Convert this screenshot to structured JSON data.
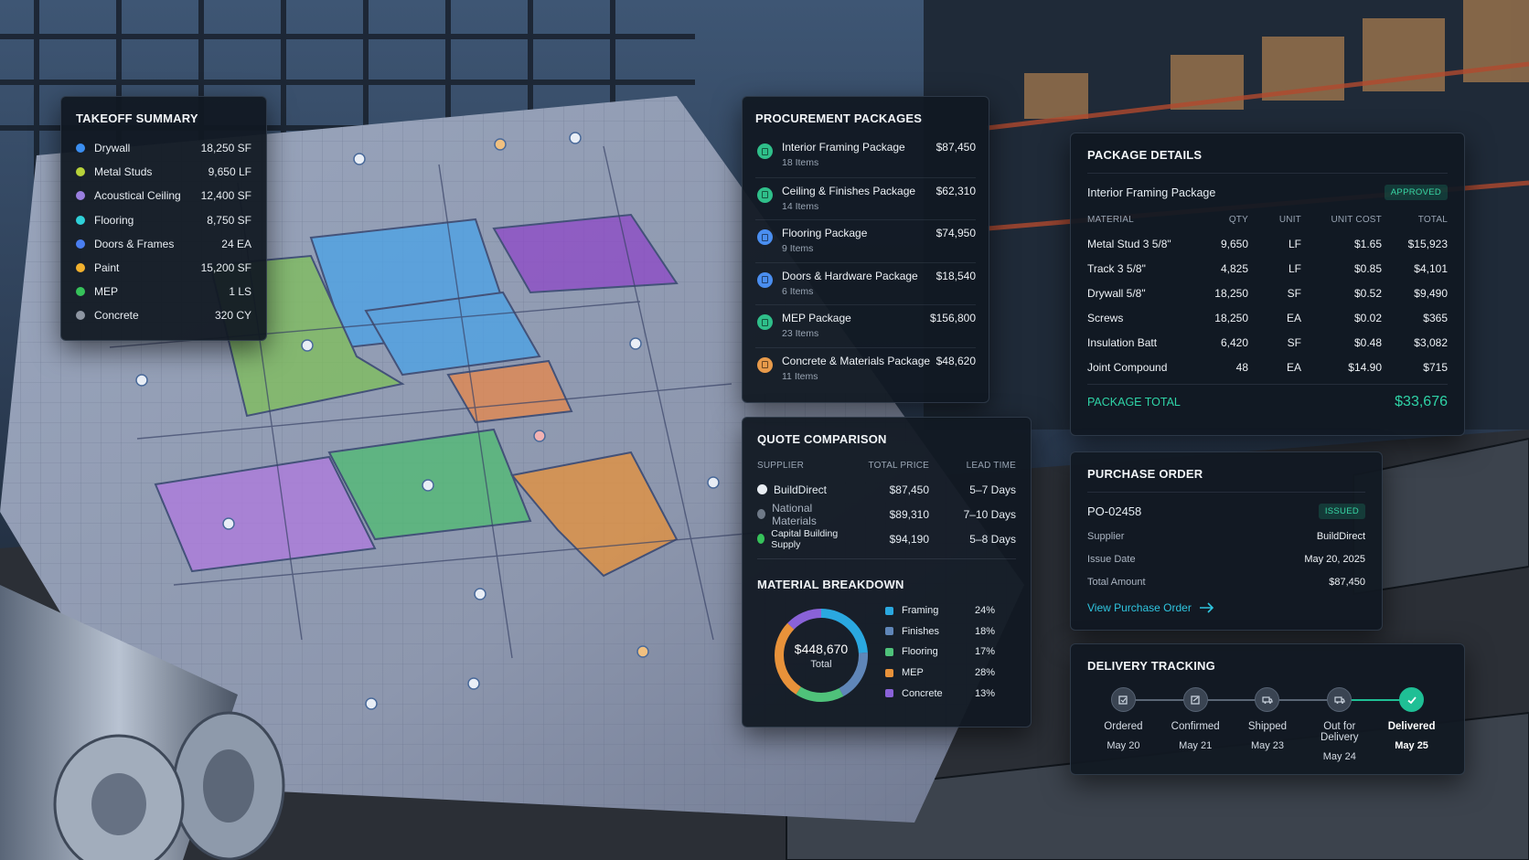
{
  "takeoff": {
    "title": "TAKEOFF SUMMARY",
    "items": [
      {
        "label": "Drywall",
        "value": "18,250 SF",
        "color": "#3b8ef0"
      },
      {
        "label": "Metal Studs",
        "value": "9,650 LF",
        "color": "#b8d23a"
      },
      {
        "label": "Acoustical Ceiling",
        "value": "12,400 SF",
        "color": "#9a7fe0"
      },
      {
        "label": "Flooring",
        "value": "8,750 SF",
        "color": "#2fd0d8"
      },
      {
        "label": "Doors & Frames",
        "value": "24 EA",
        "color": "#4a7ef0"
      },
      {
        "label": "Paint",
        "value": "15,200 SF",
        "color": "#f2b12e"
      },
      {
        "label": "MEP",
        "value": "1 LS",
        "color": "#36c25a"
      },
      {
        "label": "Concrete",
        "value": "320 CY",
        "color": "#8e96a2"
      }
    ]
  },
  "procurement": {
    "title": "PROCUREMENT PACKAGES",
    "packages": [
      {
        "name": "Interior Framing Package",
        "items": "18 Items",
        "amount": "$87,450",
        "color": "#2fbf8a"
      },
      {
        "name": "Ceiling & Finishes Package",
        "items": "14 Items",
        "amount": "$62,310",
        "color": "#2fbf8a"
      },
      {
        "name": "Flooring Package",
        "items": "9 Items",
        "amount": "$74,950",
        "color": "#4a8ef0"
      },
      {
        "name": "Doors & Hardware Package",
        "items": "6 Items",
        "amount": "$18,540",
        "color": "#4a8ef0"
      },
      {
        "name": "MEP Package",
        "items": "23 Items",
        "amount": "$156,800",
        "color": "#2fbf8a"
      },
      {
        "name": "Concrete & Materials Package",
        "items": "11 Items",
        "amount": "$48,620",
        "color": "#e89a4a"
      }
    ]
  },
  "quote": {
    "title": "QUOTE COMPARISON",
    "headers": {
      "supplier": "SUPPLIER",
      "price": "TOTAL PRICE",
      "lead": "LEAD TIME"
    },
    "rows": [
      {
        "supplier": "BuildDirect",
        "price": "$87,450",
        "lead": "5–7 Days",
        "color": "#e8edf2"
      },
      {
        "supplier": "National Materials",
        "price": "$89,310",
        "lead": "7–10 Days",
        "color": "#6f7a88"
      },
      {
        "supplier": "Capital Building Supply",
        "price": "$94,190",
        "lead": "5–8 Days",
        "color": "#36c25a"
      }
    ]
  },
  "breakdown": {
    "title": "MATERIAL BREAKDOWN",
    "total_value": "$448,670",
    "total_label": "Total",
    "segments": [
      {
        "name": "Framing",
        "pct": "24%",
        "value": 24,
        "color": "#2aa8e0"
      },
      {
        "name": "Finishes",
        "pct": "18%",
        "value": 18,
        "color": "#5f86b8"
      },
      {
        "name": "Flooring",
        "pct": "17%",
        "value": 17,
        "color": "#4fc27a"
      },
      {
        "name": "MEP",
        "pct": "28%",
        "value": 28,
        "color": "#e8923a"
      },
      {
        "name": "Concrete",
        "pct": "13%",
        "value": 13,
        "color": "#8a62d8"
      }
    ]
  },
  "details": {
    "title": "PACKAGE DETAILS",
    "package_name": "Interior Framing Package",
    "status": "APPROVED",
    "headers": {
      "material": "MATERIAL",
      "qty": "QTY",
      "unit": "UNIT",
      "unit_cost": "UNIT COST",
      "total": "TOTAL"
    },
    "rows": [
      {
        "material": "Metal Stud 3 5/8\"",
        "qty": "9,650",
        "unit": "LF",
        "unit_cost": "$1.65",
        "total": "$15,923"
      },
      {
        "material": "Track 3 5/8\"",
        "qty": "4,825",
        "unit": "LF",
        "unit_cost": "$0.85",
        "total": "$4,101"
      },
      {
        "material": "Drywall 5/8\"",
        "qty": "18,250",
        "unit": "SF",
        "unit_cost": "$0.52",
        "total": "$9,490"
      },
      {
        "material": "Screws",
        "qty": "18,250",
        "unit": "EA",
        "unit_cost": "$0.02",
        "total": "$365"
      },
      {
        "material": "Insulation Batt",
        "qty": "6,420",
        "unit": "SF",
        "unit_cost": "$0.48",
        "total": "$3,082"
      },
      {
        "material": "Joint Compound",
        "qty": "48",
        "unit": "EA",
        "unit_cost": "$14.90",
        "total": "$715"
      }
    ],
    "total_label": "PACKAGE TOTAL",
    "total_value": "$33,676"
  },
  "po": {
    "title": "PURCHASE ORDER",
    "number": "PO-02458",
    "status": "ISSUED",
    "supplier_label": "Supplier",
    "supplier": "BuildDirect",
    "issue_label": "Issue Date",
    "issue_date": "May 20, 2025",
    "amount_label": "Total Amount",
    "amount": "$87,450",
    "link": "View Purchase Order"
  },
  "delivery": {
    "title": "DELIVERY TRACKING",
    "steps": [
      {
        "label": "Ordered",
        "date": "May 20",
        "icon": "box-icon"
      },
      {
        "label": "Confirmed",
        "date": "May 21",
        "icon": "check-square-icon"
      },
      {
        "label": "Shipped",
        "date": "May 23",
        "icon": "truck-icon"
      },
      {
        "label": "Out for Delivery",
        "date": "May 24",
        "icon": "truck-icon"
      },
      {
        "label": "Delivered",
        "date": "May 25",
        "icon": "check-icon"
      }
    ]
  }
}
